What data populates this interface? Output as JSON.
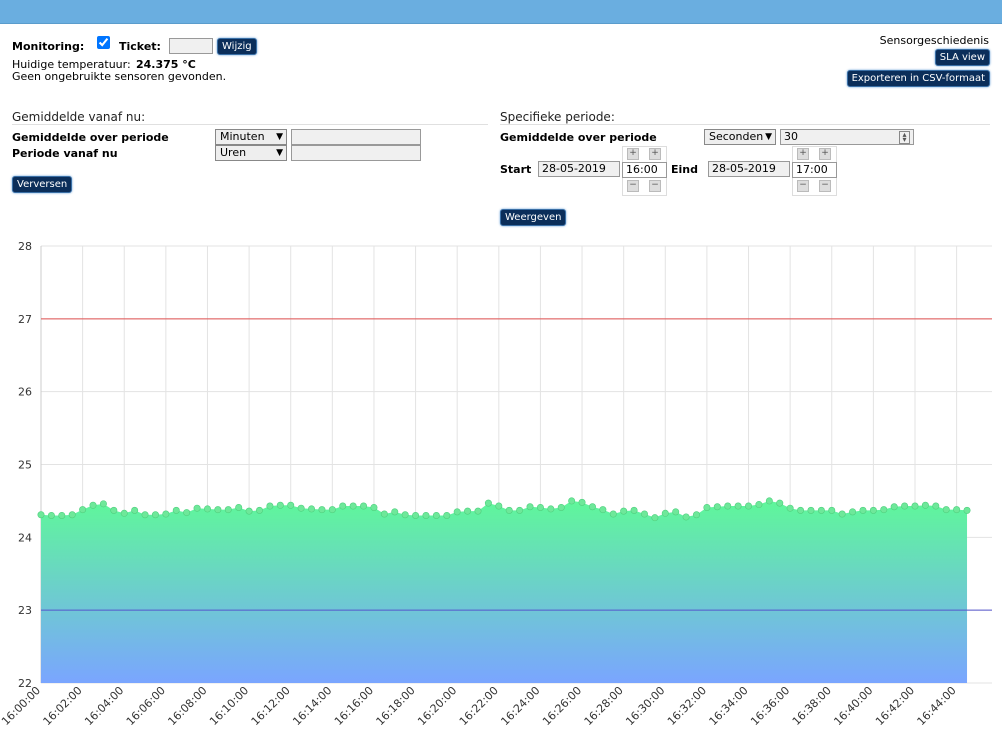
{
  "header": {
    "monitoring_label": "Monitoring:",
    "monitoring_checked": true,
    "ticket_label": "Ticket:",
    "ticket_value": "",
    "wijzig_label": "Wijzig",
    "temp_label": "Huidige temperatuur:",
    "temp_value": "24.375 °C",
    "sensor_msg": "Geen ongebruikte sensoren gevonden.",
    "history_label": "Sensorgeschiedenis",
    "sla_label": "SLA view",
    "csv_label": "Exporteren in CSV-formaat"
  },
  "left": {
    "title": "Gemiddelde vanaf nu:",
    "row1_label": "Gemiddelde over periode",
    "row1_select": "Minuten",
    "row1_value": "",
    "row2_label": "Periode vanaf nu",
    "row2_select": "Uren",
    "row2_value": "",
    "refresh_label": "Verversen"
  },
  "right": {
    "title": "Specifieke periode:",
    "avg_label": "Gemiddelde over periode",
    "avg_select": "Seconden",
    "avg_value": "30",
    "start_label": "Start",
    "start_date": "28-05-2019",
    "start_time": "16:00",
    "end_label": "Eind",
    "end_date": "28-05-2019",
    "end_time": "17:00",
    "show_label": "Weergeven"
  },
  "chart_data": {
    "type": "area",
    "ylim": [
      22,
      28
    ],
    "yticks": [
      22,
      23,
      24,
      25,
      26,
      27,
      28
    ],
    "xticks": [
      "16:00:00",
      "16:02:00",
      "16:04:00",
      "16:06:00",
      "16:08:00",
      "16:10:00",
      "16:12:00",
      "16:14:00",
      "16:16:00",
      "16:18:00",
      "16:20:00",
      "16:22:00",
      "16:24:00",
      "16:26:00",
      "16:28:00",
      "16:30:00",
      "16:32:00",
      "16:34:00",
      "16:36:00",
      "16:38:00",
      "16:40:00",
      "16:42:00",
      "16:44:00"
    ],
    "x_interval_seconds": 30,
    "threshold_high": 27,
    "threshold_low": 23,
    "colors": {
      "threshold_high": "#e05050",
      "threshold_low": "#5555cc",
      "fill_top": "#5ff79a",
      "fill_bottom": "#7aa5ff",
      "point": "#6ee89a"
    },
    "series": [
      {
        "values": [
          24.31,
          24.3,
          24.3,
          24.31,
          24.38,
          24.44,
          24.46,
          24.37,
          24.33,
          24.37,
          24.31,
          24.31,
          24.32,
          24.37,
          24.34,
          24.4,
          24.39,
          24.38,
          24.38,
          24.41,
          24.36,
          24.37,
          24.43,
          24.44,
          24.44,
          24.4,
          24.39,
          24.38,
          24.38,
          24.43,
          24.43,
          24.43,
          24.41,
          24.32,
          24.35,
          24.31,
          24.3,
          24.3,
          24.3,
          24.3,
          24.35,
          24.36,
          24.36,
          24.47,
          24.43,
          24.37,
          24.37,
          24.42,
          24.41,
          24.39,
          24.41,
          24.5,
          24.48,
          24.42,
          24.38,
          24.32,
          24.36,
          24.37,
          24.32,
          24.27,
          24.33,
          24.35,
          24.28,
          24.31,
          24.41,
          24.42,
          24.43,
          24.43,
          24.43,
          24.45,
          24.5,
          24.47,
          24.4,
          24.37,
          24.37,
          24.37,
          24.37,
          24.32,
          24.35,
          24.37,
          24.37,
          24.38,
          24.42,
          24.43,
          24.43,
          24.44,
          24.43,
          24.38,
          24.38,
          24.37
        ]
      }
    ]
  }
}
